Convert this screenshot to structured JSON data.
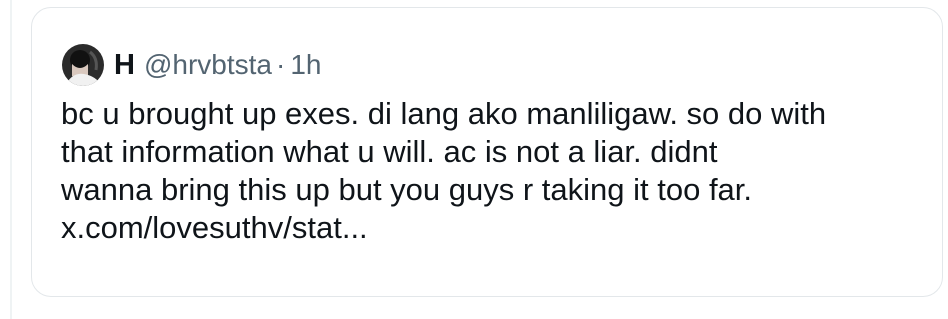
{
  "quoted_tweet": {
    "author": {
      "display_name": "H",
      "handle": "@hrvbtsta",
      "avatar_icon": "profile-photo-icon"
    },
    "separator": "·",
    "timestamp": "1h",
    "text_lines": [
      "bc u brought up exes. di lang ako manliligaw. so do with",
      "that information what u will. ac is not a liar. didnt",
      "wanna bring this up but you guys r taking it too far.",
      "x.com/lovesuthv/stat..."
    ]
  },
  "colors": {
    "text_primary": "#0f1419",
    "text_secondary": "#536471",
    "border": "#e3e7ea"
  }
}
